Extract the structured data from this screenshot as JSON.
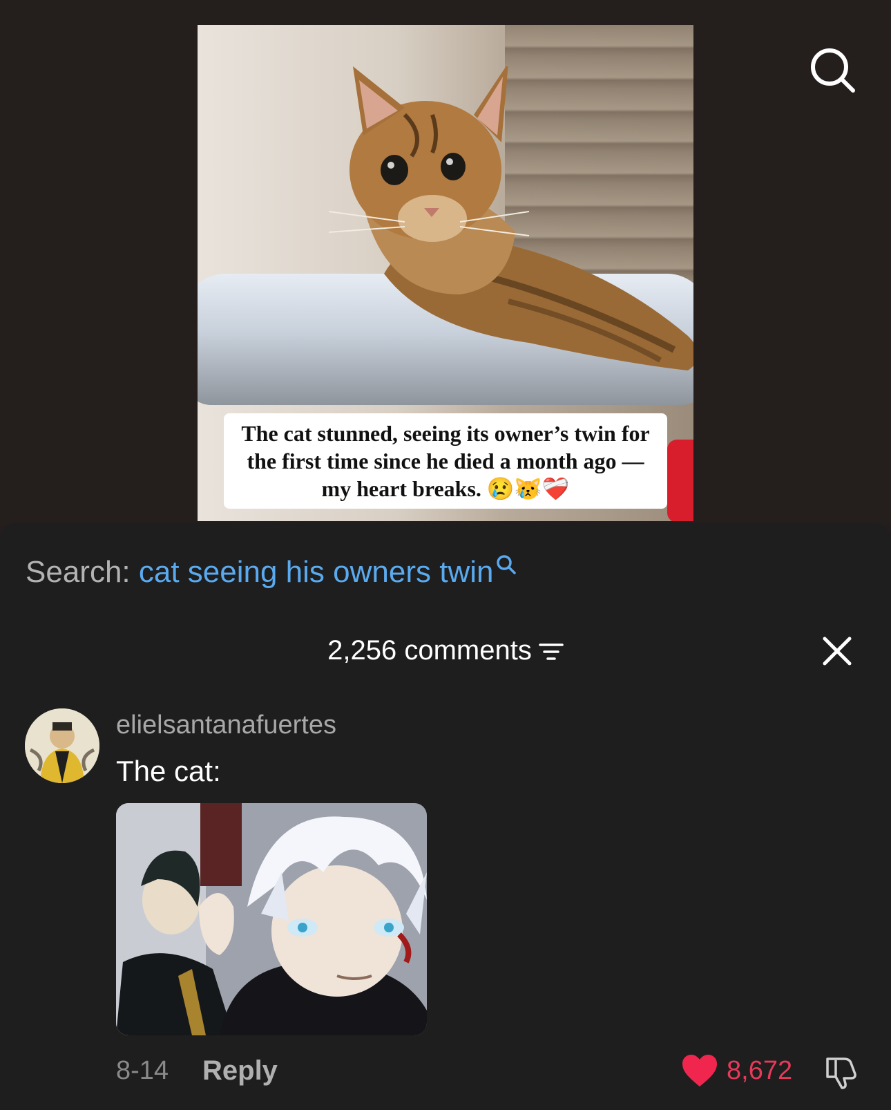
{
  "video": {
    "caption": "The cat stunned, seeing its owner’s twin for the first time since he died a month ago — my heart breaks. 😢😿❤️‍🩹"
  },
  "search": {
    "prefix": "Search:",
    "query": "cat seeing his owners twin"
  },
  "comments": {
    "count_label": "2,256 comments"
  },
  "comment": {
    "username": "elielsantanafuertes",
    "text": "The cat:",
    "date": "8-14",
    "reply_label": "Reply",
    "likes": "8,672"
  },
  "icons": {
    "top_search": "search-icon",
    "inline_search": "search-icon",
    "filter": "filter-icon",
    "close": "close-icon",
    "like": "heart-icon",
    "dislike": "thumbs-down-icon"
  },
  "colors": {
    "accent_link": "#5aaaf0",
    "like_red": "#e8395a",
    "sheet_bg": "#1e1e1e",
    "video_bg": "#241e1d"
  }
}
